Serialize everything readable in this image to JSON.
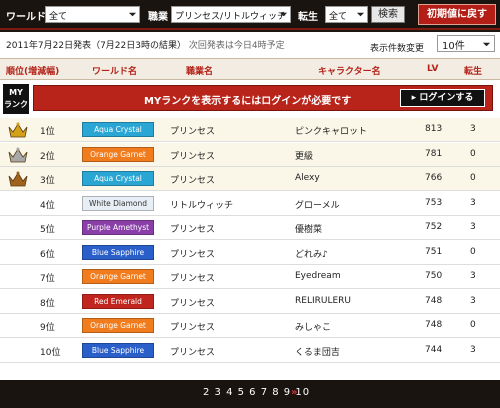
{
  "filters": {
    "world_label": "ワールド",
    "world_value": "全て",
    "job_label": "職業",
    "job_value": "プリンセス/リトルウィッチ",
    "rebirth_label": "転生",
    "rebirth_value": "全て",
    "search_button": "検索",
    "reset_button": "初期値に戻す"
  },
  "announce": {
    "main": "2011年7月22日発表（7月22日3時の結果）",
    "sub": "次回発表は今日4時予定"
  },
  "count": {
    "label": "表示件数変更",
    "value": "10件"
  },
  "columns": [
    "順位(増減幅)",
    "ワールド名",
    "職業名",
    "キャラクター名",
    "LV",
    "転生"
  ],
  "myrank": {
    "badge": "MY\nランク",
    "message": "MYランクを表示するにはログインが必要です",
    "login_button": "ログインする"
  },
  "rows": [
    {
      "rank": "1位",
      "world": "Aqua Crystal",
      "world_color": "#2aa6d4",
      "job": "プリンセス",
      "name": "ピンクキャロット",
      "lv": "813",
      "rebirth": "3",
      "crown": "gold"
    },
    {
      "rank": "2位",
      "world": "Orange Garnet",
      "world_color": "#f07c1e",
      "job": "プリンセス",
      "name": "更級",
      "lv": "781",
      "rebirth": "0",
      "crown": "silver"
    },
    {
      "rank": "3位",
      "world": "Aqua Crystal",
      "world_color": "#2aa6d4",
      "job": "プリンセス",
      "name": "Alexy",
      "lv": "766",
      "rebirth": "0",
      "crown": "bronze"
    },
    {
      "rank": "4位",
      "world": "White Diamond",
      "world_color": "#e8eef5",
      "job": "リトルウィッチ",
      "name": "グローメル",
      "lv": "753",
      "rebirth": "3",
      "crown": ""
    },
    {
      "rank": "5位",
      "world": "Purple Amethyst",
      "world_color": "#8a3fa8",
      "job": "プリンセス",
      "name": "優樹菜",
      "lv": "752",
      "rebirth": "3",
      "crown": ""
    },
    {
      "rank": "6位",
      "world": "Blue Sapphire",
      "world_color": "#2a5fc9",
      "job": "プリンセス",
      "name": "どれみ♪",
      "lv": "751",
      "rebirth": "0",
      "crown": ""
    },
    {
      "rank": "7位",
      "world": "Orange Garnet",
      "world_color": "#f07c1e",
      "job": "プリンセス",
      "name": "Eyedream",
      "lv": "750",
      "rebirth": "3",
      "crown": ""
    },
    {
      "rank": "8位",
      "world": "Red Emerald",
      "world_color": "#c1261e",
      "job": "プリンセス",
      "name": "RELIRULERU",
      "lv": "748",
      "rebirth": "3",
      "crown": ""
    },
    {
      "rank": "9位",
      "world": "Orange Garnet",
      "world_color": "#f07c1e",
      "job": "プリンセス",
      "name": "みしゃこ",
      "lv": "748",
      "rebirth": "0",
      "crown": ""
    },
    {
      "rank": "10位",
      "world": "Blue Sapphire",
      "world_color": "#2a5fc9",
      "job": "プリンセス",
      "name": "くるま団吉",
      "lv": "744",
      "rebirth": "3",
      "crown": ""
    }
  ],
  "pager": {
    "pages": "2 3 4 5 6 7 8 9 10",
    "next": "»"
  }
}
